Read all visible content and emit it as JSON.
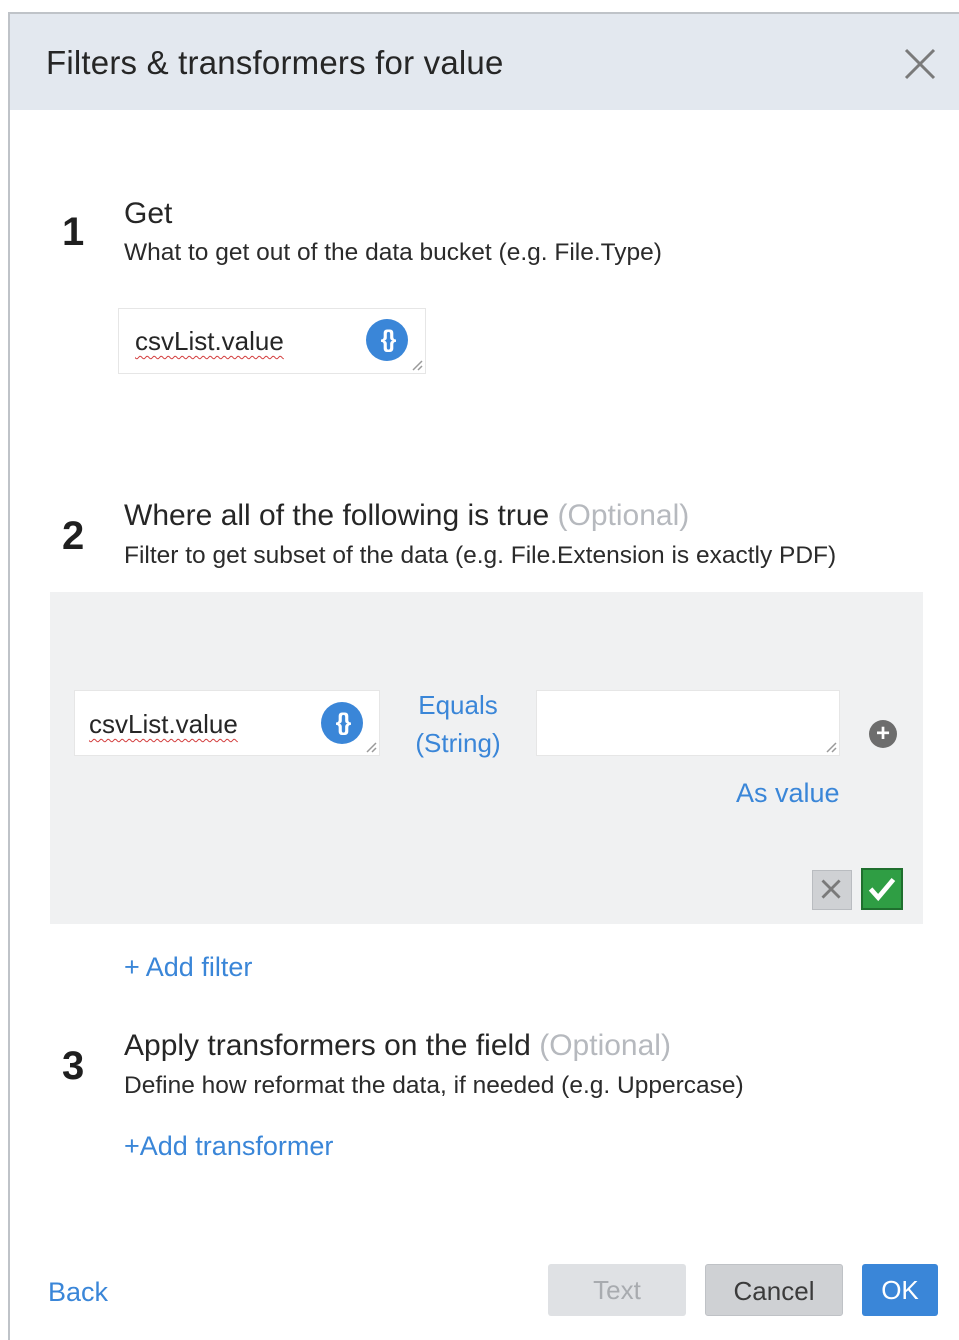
{
  "dialog": {
    "title": "Filters & transformers for value"
  },
  "step1": {
    "number": "1",
    "title": "Get",
    "description": "What to get out of the data bucket (e.g. File.Type)",
    "field_value": "csvList.value",
    "brace_symbol": "{}"
  },
  "step2": {
    "number": "2",
    "title": "Where all of the following is true",
    "optional": "(Optional)",
    "description": "Filter to get subset of the data (e.g. File.Extension is exactly PDF)",
    "filter": {
      "left_value": "csvList.value",
      "brace_symbol": "{}",
      "operator_line1": "Equals",
      "operator_line2": "(String)",
      "right_value": "",
      "as_value": "As value",
      "plus_symbol": "+"
    },
    "add_filter": "+ Add filter"
  },
  "step3": {
    "number": "3",
    "title": "Apply transformers on the field",
    "optional": "(Optional)",
    "description": "Define how reformat the data, if needed (e.g. Uppercase)",
    "add_transformer": "+Add transformer"
  },
  "footer": {
    "back": "Back",
    "text": "Text",
    "cancel": "Cancel",
    "ok": "OK"
  },
  "colors": {
    "accent": "#3a86d8",
    "header_bg": "#e3e8ef",
    "panel_bg": "#f0f1f2",
    "confirm_green": "#2f9e44",
    "optional_gray": "#b6b9be"
  },
  "icons": [
    "close-icon",
    "brace-icon",
    "resize-handle-icon",
    "plus-circle-icon",
    "x-icon",
    "checkmark-icon"
  ]
}
